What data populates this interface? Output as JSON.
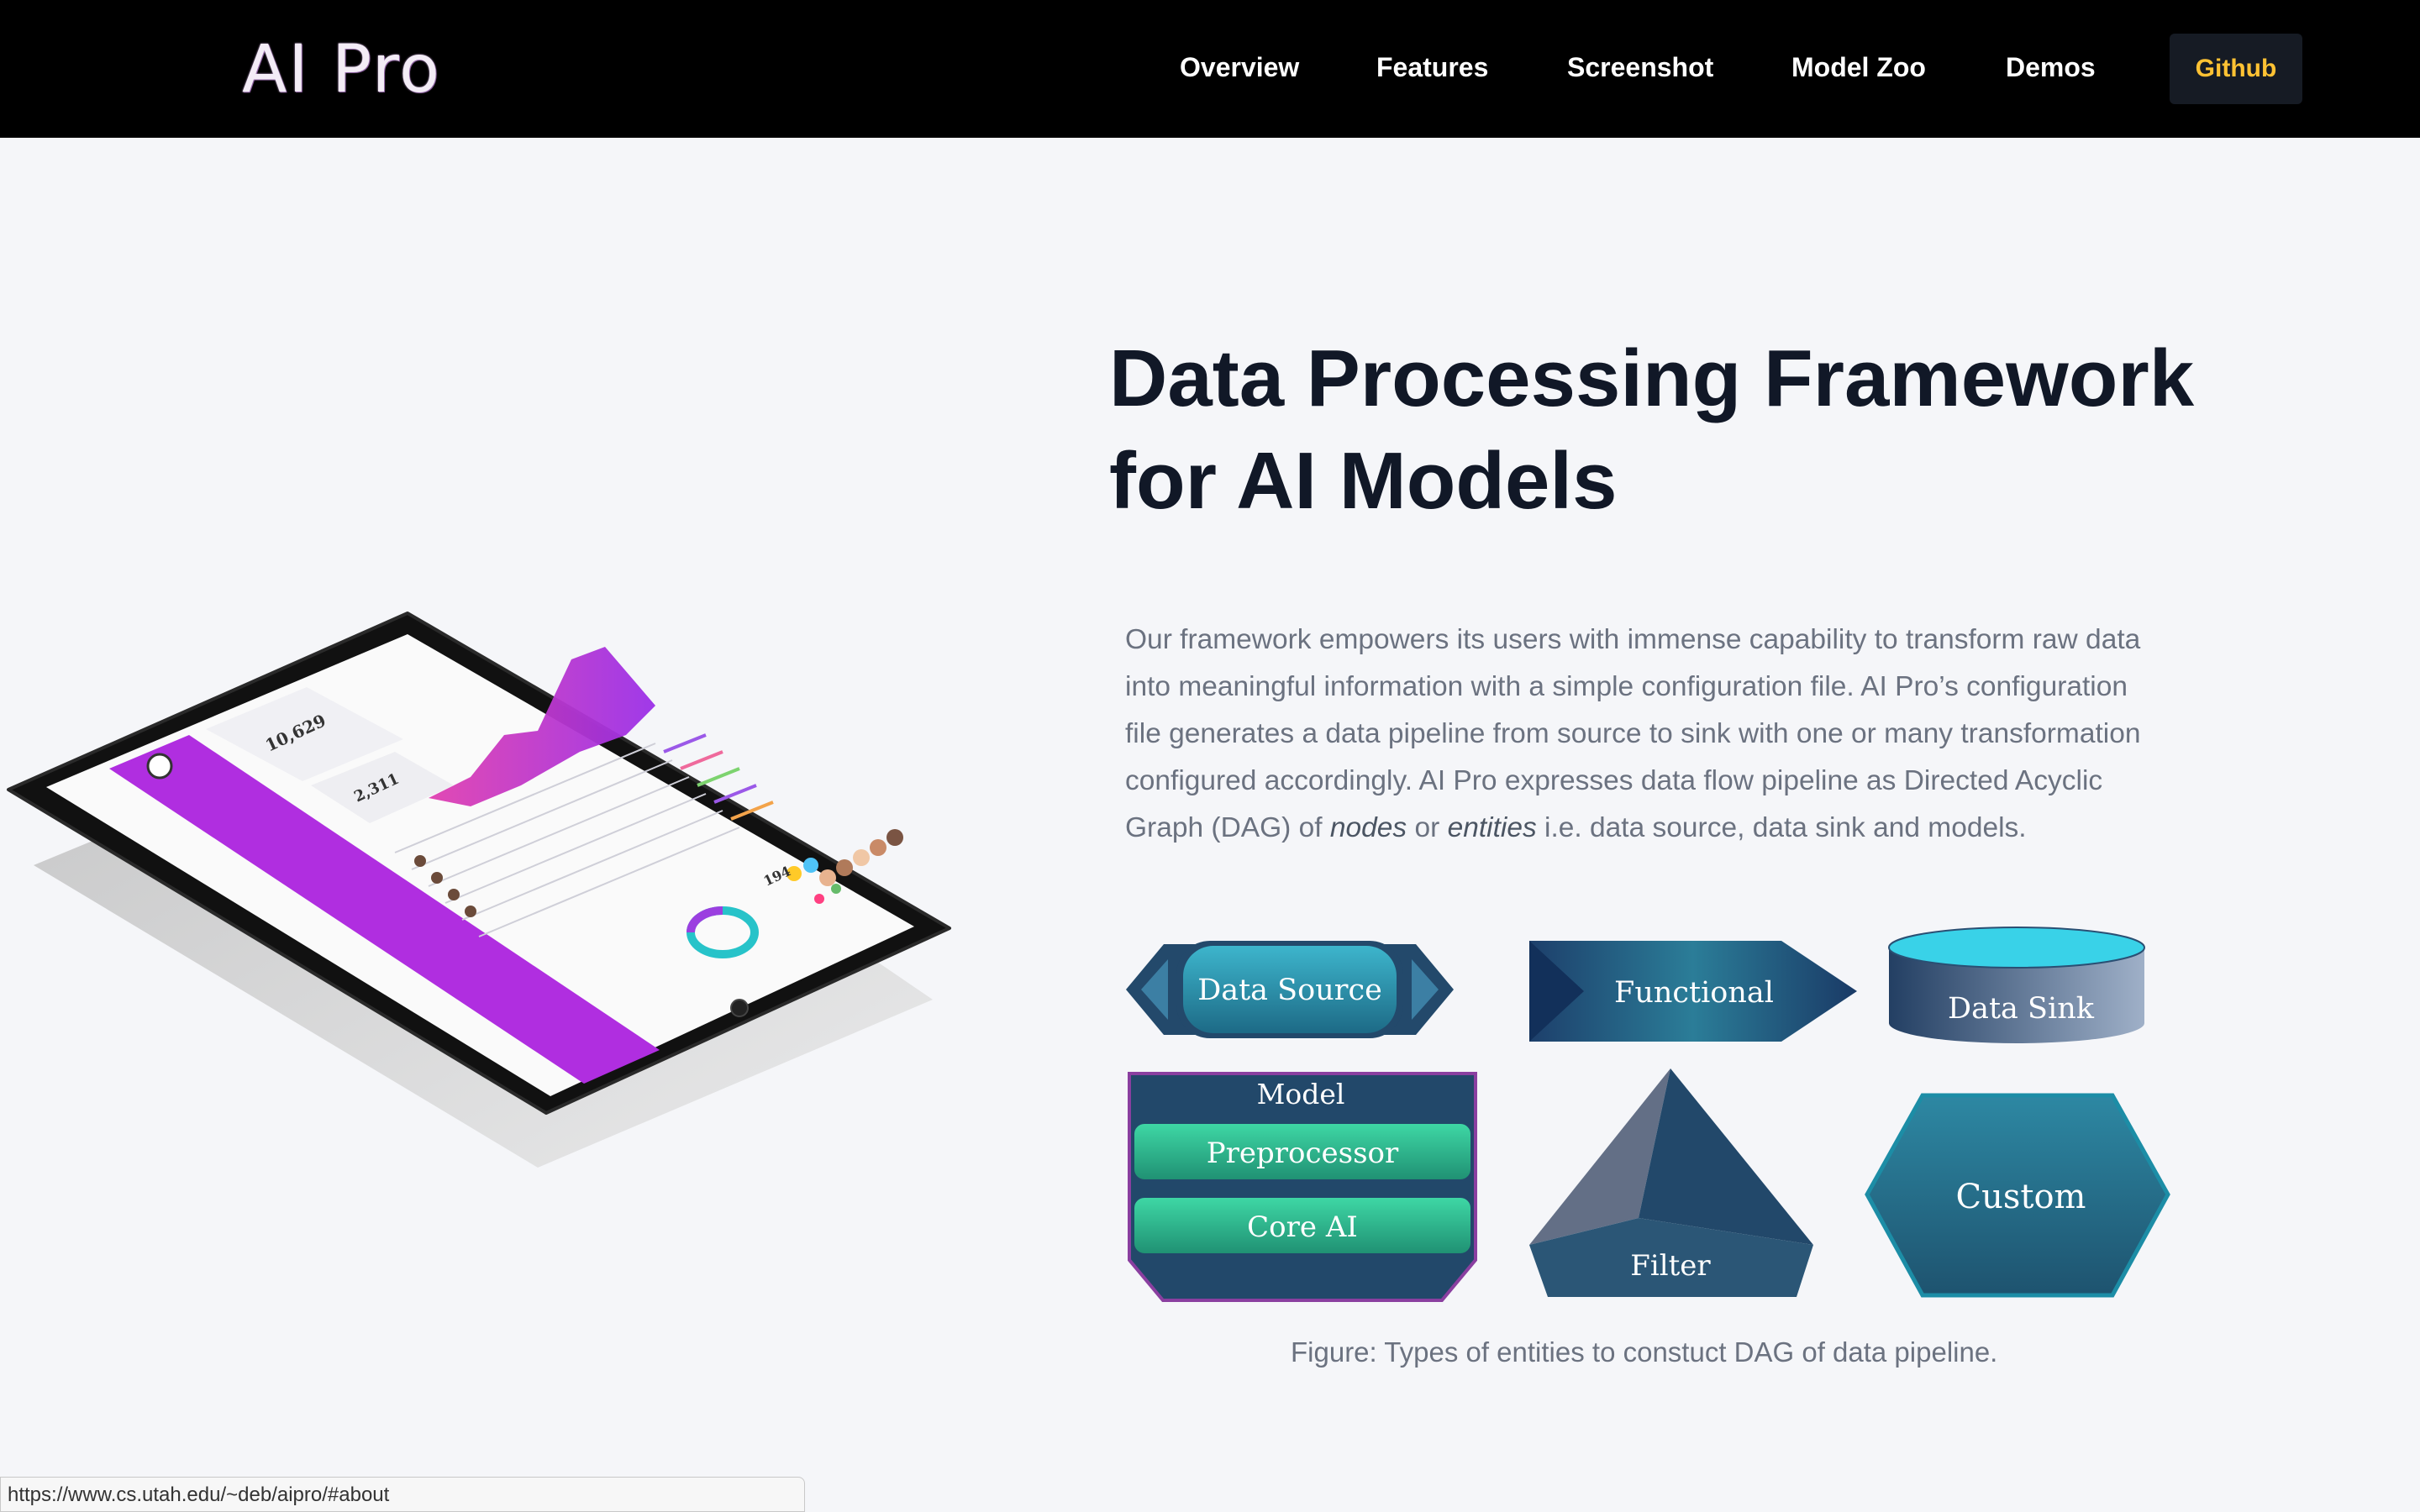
{
  "brand": {
    "logo": "AI Pro"
  },
  "nav": {
    "items": [
      {
        "label": "Overview"
      },
      {
        "label": "Features"
      },
      {
        "label": "Screenshot"
      },
      {
        "label": "Model Zoo"
      },
      {
        "label": "Demos"
      }
    ],
    "github_label": "Github"
  },
  "hero": {
    "title": "Data Processing Framework for AI Models",
    "description_parts": {
      "p1": "Our framework empowers its users with immense capability to transform raw data into meaningful information with a simple configuration file. AI Pro’s configuration file generates a data pipeline from source to sink with one or many transformation configured accordingly. AI Pro expresses data flow pipeline as Directed Acyclic Graph (DAG) of ",
      "nodes": "nodes",
      "or": " or ",
      "entities": "entities",
      "p2": " i.e. data source, data sink and models."
    }
  },
  "tablet_mockup": {
    "metric_1": "10,629",
    "metric_2": "2,311",
    "metric_3": "194"
  },
  "figure": {
    "shapes": {
      "data_source": "Data Source",
      "functional": "Functional",
      "data_sink": "Data Sink",
      "model": "Model",
      "preprocessor": "Preprocessor",
      "core_ai": "Core AI",
      "filter": "Filter",
      "custom": "Custom"
    },
    "caption": "Figure: Types of entities to constuct DAG of data pipeline."
  },
  "status_bar": {
    "url": "https://www.cs.utah.edu/~deb/aipro/#about"
  },
  "colors": {
    "navbar": "#000000",
    "github_text": "#ffc233",
    "tablet_accent": "#b02ee0",
    "teal": "#2b7d98",
    "navy": "#1d3f66",
    "green": "#2fbf8e"
  }
}
